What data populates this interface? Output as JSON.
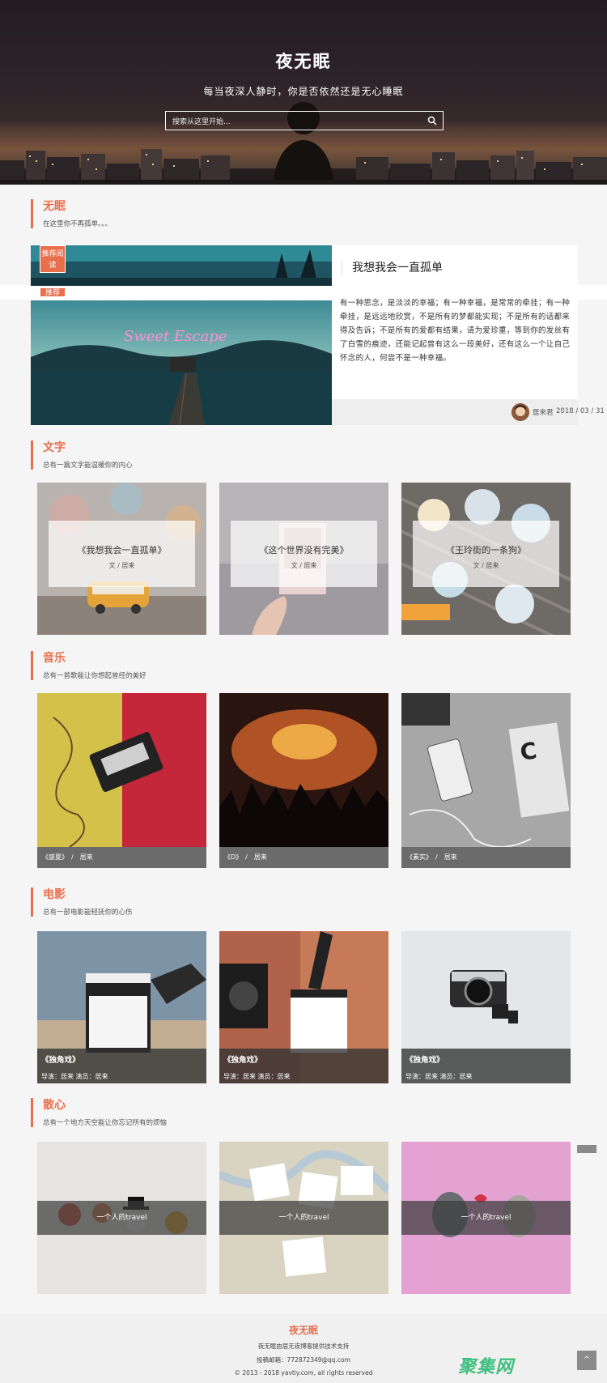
{
  "hero": {
    "title": "夜无眠",
    "subtitle": "每当夜深人静时，你是否依然还是无心睡眠",
    "search_placeholder": "搜索从这里开始..."
  },
  "sections": {
    "wumian": {
      "title": "无眠",
      "desc": "在这里你不再孤单。。。"
    },
    "wenzi": {
      "title": "文字",
      "desc": "总有一篇文字能温暖你的内心"
    },
    "yinyue": {
      "title": "音乐",
      "desc": "总有一首歌能让你想起曾经的美好"
    },
    "dianying": {
      "title": "电影",
      "desc": "总有一部电影能轻抚你的心伤"
    },
    "sanxin": {
      "title": "散心",
      "desc": "总有一个地方天空能让你忘记所有的烦恼"
    }
  },
  "featured": {
    "tag1": "推荐阅读",
    "tag2": "推荐",
    "title": "我想我会一直孤单",
    "excerpt": "有一种思念，是淡淡的幸福；有一种幸福，是常常的牵挂；有一种牵挂，是远远地欣赏，不是所有的梦都能实现；不是所有的话都来得及告诉；不是所有的爱都有结果，请为爱珍重，等到你的发丝有了白雪的痕迹，还能记起曾有这么一段美好，还有这么一个让自己怀念的人，何尝不是一种幸福。",
    "author": "居来君",
    "date": "2018 / 03 / 31",
    "neon_text": "Sweet Escape"
  },
  "writing_cards": [
    {
      "title": "《我想我会一直孤单》",
      "author": "文 / 居来"
    },
    {
      "title": "《这个世界没有完美》",
      "author": "文 / 居来"
    },
    {
      "title": "《王玲街的一条狗》",
      "author": "文 / 居来"
    }
  ],
  "music_cards": [
    {
      "label": "《盛夏》　/　居来"
    },
    {
      "label": "《D》　/　居来"
    },
    {
      "label": "《素实》　/　居来"
    }
  ],
  "movie_cards": [
    {
      "title": "《独角戏》",
      "credits": "导演：居来  演员：居来"
    },
    {
      "title": "《独角戏》",
      "credits": "导演：居来  演员：居来"
    },
    {
      "title": "《独角戏》",
      "credits": "导演：居来  演员：居来"
    }
  ],
  "travel_cards": [
    {
      "label": "一个人的travel"
    },
    {
      "label": "一个人的travel"
    },
    {
      "label": "一个人的travel"
    }
  ],
  "footer": {
    "title": "夜无眠",
    "line1": "夜无眠由居无夜博客提供技术支持",
    "line2": "投稿邮箱：772872349@qq.com",
    "line3": "© 2013 - 2018 yavtiy.com, all rights reserved"
  },
  "to_top": "^",
  "watermark": "聚集网",
  "colors": {
    "accent": "#e86e4c",
    "bar": "#6b6b6b"
  }
}
